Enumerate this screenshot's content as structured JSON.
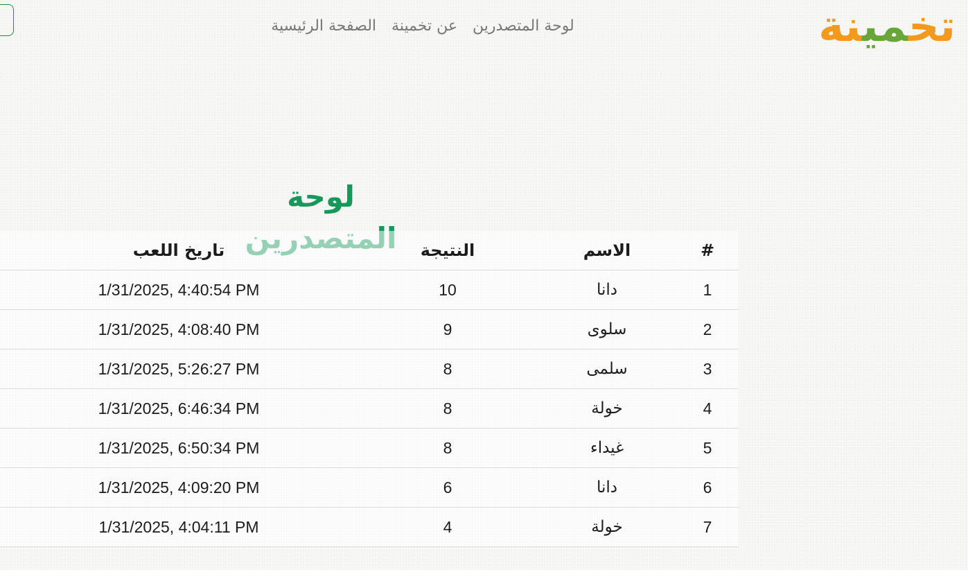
{
  "brand": {
    "logo_parts": [
      "تخ",
      "مي",
      "نة"
    ],
    "colors": {
      "orange": "#f39a1d",
      "green": "#6aa53a",
      "accent": "#17985b"
    }
  },
  "nav": {
    "items": [
      {
        "label": "الصفحة الرئيسية"
      },
      {
        "label": "عن تخمينة"
      },
      {
        "label": "لوحة المتصدرين"
      }
    ]
  },
  "page": {
    "title": "لوحة المتصدرين"
  },
  "leaderboard": {
    "headers": {
      "rank": "#",
      "name": "الاسم",
      "score": "النتيجة",
      "date": "تاريخ اللعب"
    },
    "rows": [
      {
        "rank": "1",
        "name": "دانا",
        "score": "10",
        "date": "1/31/2025, 4:40:54 PM"
      },
      {
        "rank": "2",
        "name": "سلوى",
        "score": "9",
        "date": "1/31/2025, 4:08:40 PM"
      },
      {
        "rank": "3",
        "name": "سلمى",
        "score": "8",
        "date": "1/31/2025, 5:26:27 PM"
      },
      {
        "rank": "4",
        "name": "خولة",
        "score": "8",
        "date": "1/31/2025, 6:46:34 PM"
      },
      {
        "rank": "5",
        "name": "غيداء",
        "score": "8",
        "date": "1/31/2025, 6:50:34 PM"
      },
      {
        "rank": "6",
        "name": "دانا",
        "score": "6",
        "date": "1/31/2025, 4:09:20 PM"
      },
      {
        "rank": "7",
        "name": "خولة",
        "score": "4",
        "date": "1/31/2025, 4:04:11 PM"
      }
    ]
  }
}
